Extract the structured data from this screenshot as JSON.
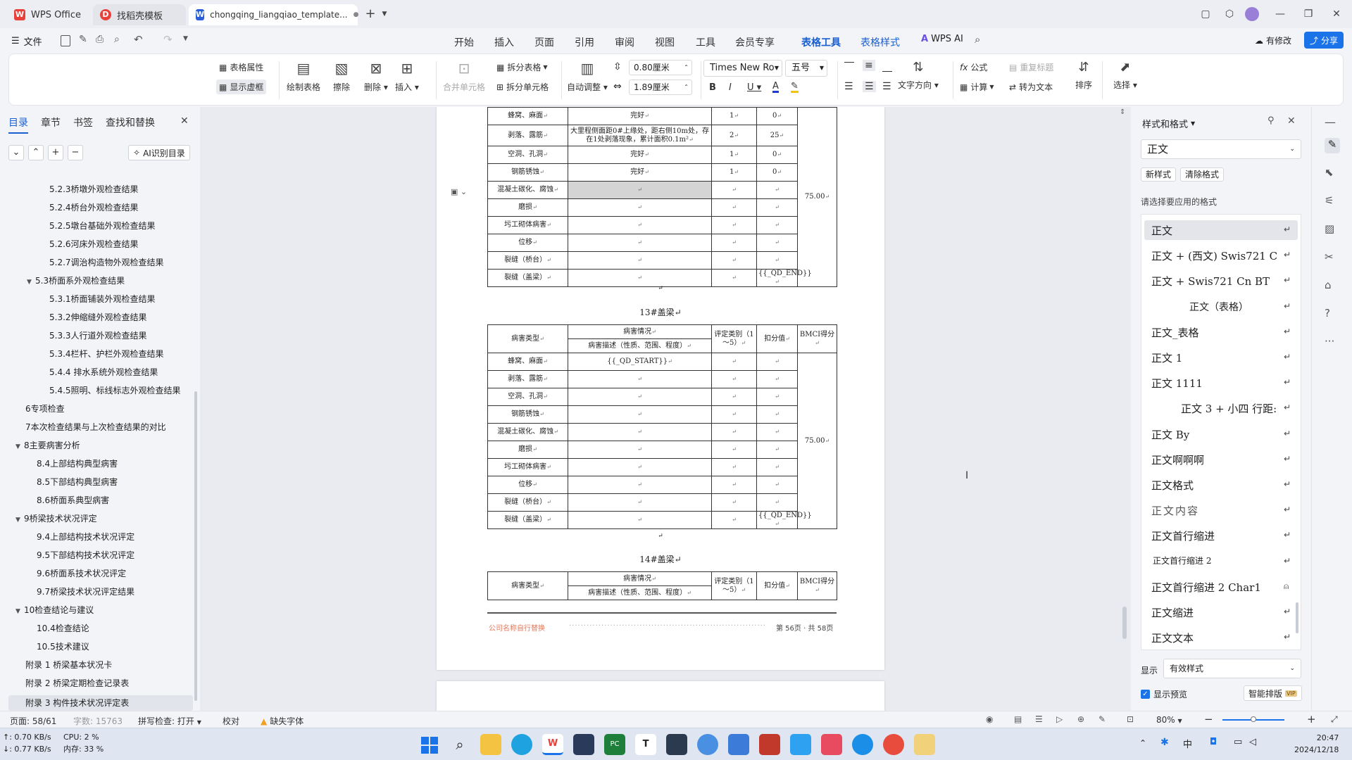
{
  "titlebar": {
    "tabs": [
      {
        "label": "WPS Office"
      },
      {
        "label": "找稻壳模板"
      },
      {
        "label": "chongqing_liangqiao_template..."
      }
    ],
    "dirty_marker": "●",
    "new_tab": "+"
  },
  "menubar": {
    "file": "文件",
    "items": [
      "开始",
      "插入",
      "页面",
      "引用",
      "审阅",
      "视图",
      "工具",
      "会员专享",
      "表格工具",
      "表格样式"
    ],
    "ai": "WPS AI",
    "modified": "有修改",
    "share": "分享"
  },
  "ribbon": {
    "table_props": "表格属性",
    "show_gridlines": "显示虚框",
    "draw_table": "绘制表格",
    "erase": "擦除",
    "delete": "删除",
    "insert": "插入",
    "merge_cells": "合并单元格",
    "split_table": "拆分表格",
    "split_cells": "拆分单元格",
    "auto_fit": "自动调整",
    "row_height": "0.80厘米",
    "col_width": "1.89厘米",
    "font_name": "Times New Ro",
    "font_size": "五号",
    "text_direction": "文字方向",
    "formula": "公式",
    "calculate": "计算",
    "repeat_header": "重复标题",
    "to_text": "转为文本",
    "sort": "排序",
    "select": "选择"
  },
  "leftpanel": {
    "tabs": [
      "目录",
      "章节",
      "书签",
      "查找和替换"
    ],
    "ai_toc": "AI识别目录",
    "toc": [
      {
        "label": "5.2.3桥墩外观检查结果",
        "level": 3
      },
      {
        "label": "5.2.4桥台外观检查结果",
        "level": 3
      },
      {
        "label": "5.2.5墩台基础外观检查结果",
        "level": 3
      },
      {
        "label": "5.2.6河床外观检查结果",
        "level": 3
      },
      {
        "label": "5.2.7调治构造物外观检查结果",
        "level": 3
      },
      {
        "label": "5.3桥面系外观检查结果",
        "level": 2,
        "expanded": true
      },
      {
        "label": "5.3.1桥面铺装外观检查结果",
        "level": 3
      },
      {
        "label": "5.3.2伸缩缝外观检查结果",
        "level": 3
      },
      {
        "label": "5.3.3人行道外观检查结果",
        "level": 3
      },
      {
        "label": "5.3.4栏杆、护栏外观检查结果",
        "level": 3
      },
      {
        "label": "5.4.4 排水系统外观检查结果",
        "level": 3
      },
      {
        "label": "5.4.5照明、标线标志外观检查结果",
        "level": 3
      },
      {
        "label": "6专项检查",
        "level": 1
      },
      {
        "label": "7本次检查结果与上次检查结果的对比",
        "level": 1
      },
      {
        "label": "8主要病害分析",
        "level": 1,
        "expanded": true
      },
      {
        "label": "8.4上部结构典型病害",
        "level": 2
      },
      {
        "label": "8.5下部结构典型病害",
        "level": 2
      },
      {
        "label": "8.6桥面系典型病害",
        "level": 2
      },
      {
        "label": "9桥梁技术状况评定",
        "level": 1,
        "expanded": true
      },
      {
        "label": "9.4上部结构技术状况评定",
        "level": 2
      },
      {
        "label": "9.5下部结构技术状况评定",
        "level": 2
      },
      {
        "label": "9.6桥面系技术状况评定",
        "level": 2
      },
      {
        "label": "9.7桥梁技术状况评定结果",
        "level": 2
      },
      {
        "label": "10检查结论与建议",
        "level": 1,
        "expanded": true
      },
      {
        "label": "10.4检查结论",
        "level": 2
      },
      {
        "label": "10.5技术建议",
        "level": 2
      },
      {
        "label": "附录 1 桥梁基本状况卡",
        "level": 1
      },
      {
        "label": "附录 2 桥梁定期检查记录表",
        "level": 1
      },
      {
        "label": "附录 3 构件技术状况评定表",
        "level": 1,
        "selected": true
      }
    ]
  },
  "document": {
    "table1_rows": [
      {
        "type": "蜂窝、麻面",
        "desc": "完好",
        "cat": "1",
        "ded": "0"
      },
      {
        "type": "剥落、露筋",
        "desc": "大里程侧面距0#上缘处，距右侧10m处，存在1处剥落现象，累计面积0.1m²",
        "cat": "2",
        "ded": "25"
      },
      {
        "type": "空洞、孔洞",
        "desc": "完好",
        "cat": "1",
        "ded": "0"
      },
      {
        "type": "钢筋锈蚀",
        "desc": "完好",
        "cat": "1",
        "ded": "0"
      },
      {
        "type": "混凝土碳化、腐蚀",
        "desc": "",
        "cat": "",
        "ded": ""
      },
      {
        "type": "磨损",
        "desc": "",
        "cat": "",
        "ded": ""
      },
      {
        "type": "圬工砌体病害",
        "desc": "",
        "cat": "",
        "ded": ""
      },
      {
        "type": "位移",
        "desc": "",
        "cat": "",
        "ded": ""
      },
      {
        "type": "裂缝（桥台）",
        "desc": "",
        "cat": "",
        "ded": ""
      },
      {
        "type": "裂缝（盖梁）",
        "desc": "",
        "cat": "",
        "ded": "{{_QD_END}}"
      }
    ],
    "table1_score": "75.00",
    "caption2": "13#盖梁",
    "header": {
      "type": "病害类型",
      "situation": "病害情况",
      "desc": "病害描述（性质、范围、程度）",
      "cat": "评定类别（1～5）",
      "ded": "扣分值",
      "bmci": "BMCI得分"
    },
    "table2_rows": [
      {
        "type": "蜂窝、麻面",
        "desc": "{{_QD_START}}",
        "cat": "",
        "ded": ""
      },
      {
        "type": "剥落、露筋",
        "desc": "",
        "cat": "",
        "ded": ""
      },
      {
        "type": "空洞、孔洞",
        "desc": "",
        "cat": "",
        "ded": ""
      },
      {
        "type": "钢筋锈蚀",
        "desc": "",
        "cat": "",
        "ded": ""
      },
      {
        "type": "混凝土碳化、腐蚀",
        "desc": "",
        "cat": "",
        "ded": ""
      },
      {
        "type": "磨损",
        "desc": "",
        "cat": "",
        "ded": ""
      },
      {
        "type": "圬工砌体病害",
        "desc": "",
        "cat": "",
        "ded": ""
      },
      {
        "type": "位移",
        "desc": "",
        "cat": "",
        "ded": ""
      },
      {
        "type": "裂缝（桥台）",
        "desc": "",
        "cat": "",
        "ded": ""
      },
      {
        "type": "裂缝（盖梁）",
        "desc": "",
        "cat": "",
        "ded": "{{_QD_END}}"
      }
    ],
    "table2_score": "75.00",
    "caption3": "14#盖梁",
    "footer_left": "公司名称自行替换",
    "footer_right": "第 56页 · 共 58页"
  },
  "rightpanel": {
    "title": "样式和格式",
    "current_style": "正文",
    "new_style": "新样式",
    "clear_format": "清除格式",
    "prompt": "请选择要应用的格式",
    "styles": [
      {
        "label": "正文",
        "selected": true
      },
      {
        "label": "正文 + (西文) Swis721 C"
      },
      {
        "label": "正文 + Swis721 Cn BT"
      },
      {
        "label": "正文（表格）"
      },
      {
        "label": "正文_表格"
      },
      {
        "label": "正文 1"
      },
      {
        "label": "正文 1111"
      },
      {
        "label": "正文 3 + 小四 行距:"
      },
      {
        "label": "正文 By"
      },
      {
        "label": "正文啊啊啊"
      },
      {
        "label": "正文格式"
      },
      {
        "label": "正文内容"
      },
      {
        "label": "正文首行缩进"
      },
      {
        "label": "正文首行缩进 2"
      },
      {
        "label": "正文首行缩进 2 Char1"
      },
      {
        "label": "正文缩进"
      },
      {
        "label": "正文文本"
      }
    ],
    "show_label": "显示",
    "show_value": "有效样式",
    "preview_label": "显示预览",
    "smart_layout": "智能排版",
    "vip": "VIP"
  },
  "statusbar": {
    "page": "页面: 58/61",
    "words": "字数: 15763",
    "spell": "拼写检查: 打开",
    "proof": "校对",
    "missing_font": "缺失字体",
    "zoom": "80%"
  },
  "taskbar": {
    "net_up": "↑: 0.70 KB/s",
    "net_down": "↓: 0.77 KB/s",
    "cpu": "CPU: 2 %",
    "mem": "内存: 33 %",
    "time": "20:47",
    "date": "2024/12/18"
  },
  "colors": {
    "accent": "#1a5fd0",
    "wps_red": "#e8413c"
  }
}
